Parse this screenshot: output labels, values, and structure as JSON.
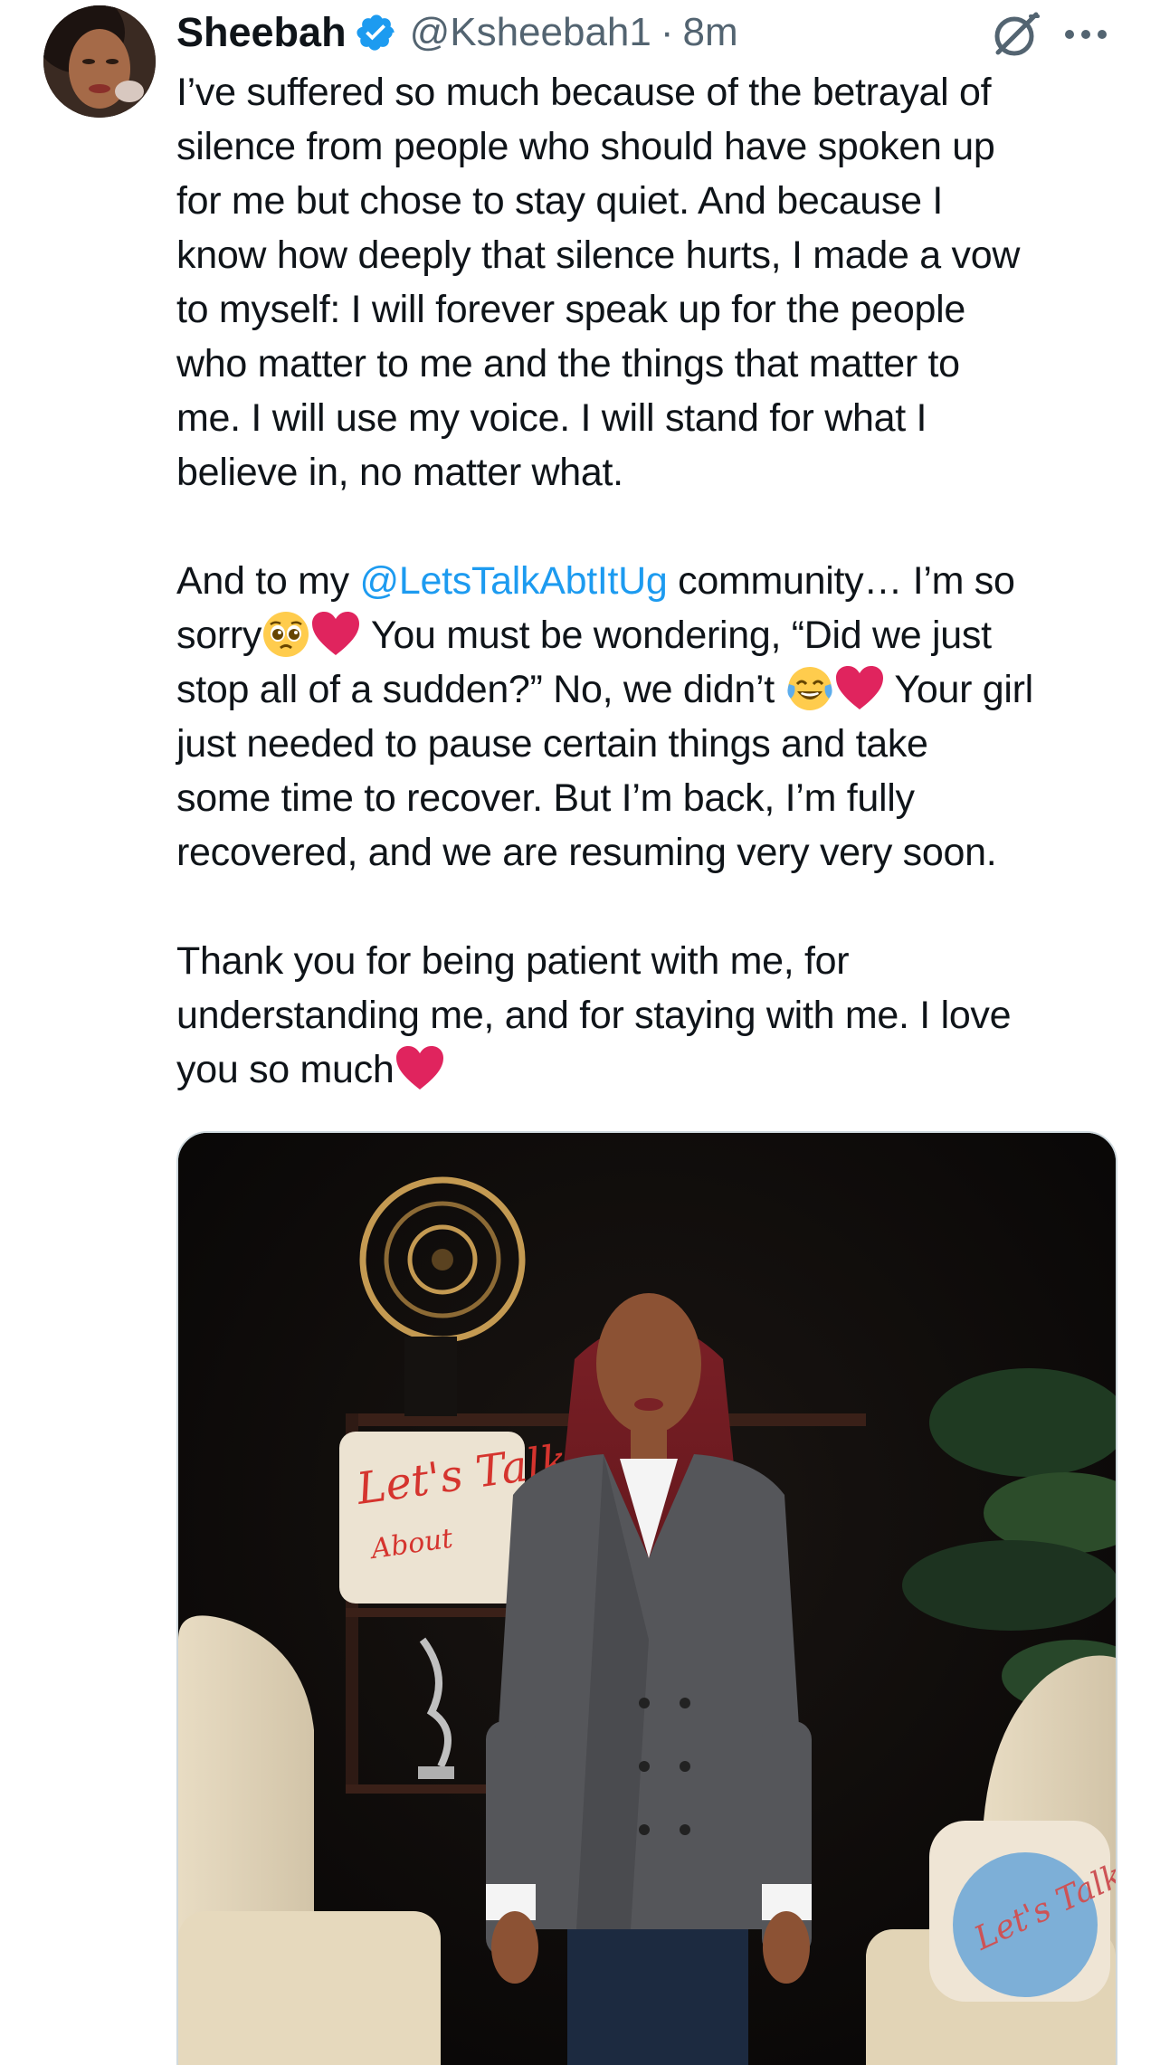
{
  "tweet": {
    "display_name": "Sheebah",
    "handle": "@Ksheebah1",
    "separator": "·",
    "time": "8m",
    "paragraphs": [
      {
        "lines": [
          "I’ve suffered so much because of the betrayal of",
          "silence from people who should have spoken up",
          "for me but chose to stay quiet. And because I",
          "know how deeply that silence hurts, I made a vow",
          "to myself: I will forever speak up for the people",
          "who matter to me and the things that matter to",
          "me. I will use my voice. I will stand for what I",
          "believe in, no matter what."
        ]
      },
      {
        "line1_before": "And to my ",
        "mention": "@LetsTalkAbtItUg",
        "line1_after": " community… I’m so",
        "line2_start": "sorry",
        "line2_end": " You must be wondering, “Did we just",
        "line3_start": "stop all of a sudden?” No, we didn’t ",
        "line3_end": " Your girl",
        "lines_rest": [
          "just needed to pause certain things and take",
          "some time to recover. But I’m back, I’m fully",
          "recovered, and we are resuming very very soon."
        ]
      },
      {
        "lines": [
          "Thank you for being patient with me, for",
          "understanding me, and for staying with me. I love"
        ],
        "last_line": "you so much"
      }
    ],
    "icons": {
      "verified": "verified-badge-icon",
      "grok": "grok-icon",
      "more": "more-options-icon",
      "heart": "red-heart-emoji",
      "pleading": "pleading-face-emoji",
      "laughing": "face-with-tears-of-joy-emoji"
    },
    "colors": {
      "text": "#0f1419",
      "secondary": "#536471",
      "link": "#1d9bf0",
      "heart": "#e0245e"
    },
    "media": {
      "pillow_text": "Let's Talk",
      "pillow_subtext": "About",
      "watermark_text": "Let's Talk"
    }
  }
}
